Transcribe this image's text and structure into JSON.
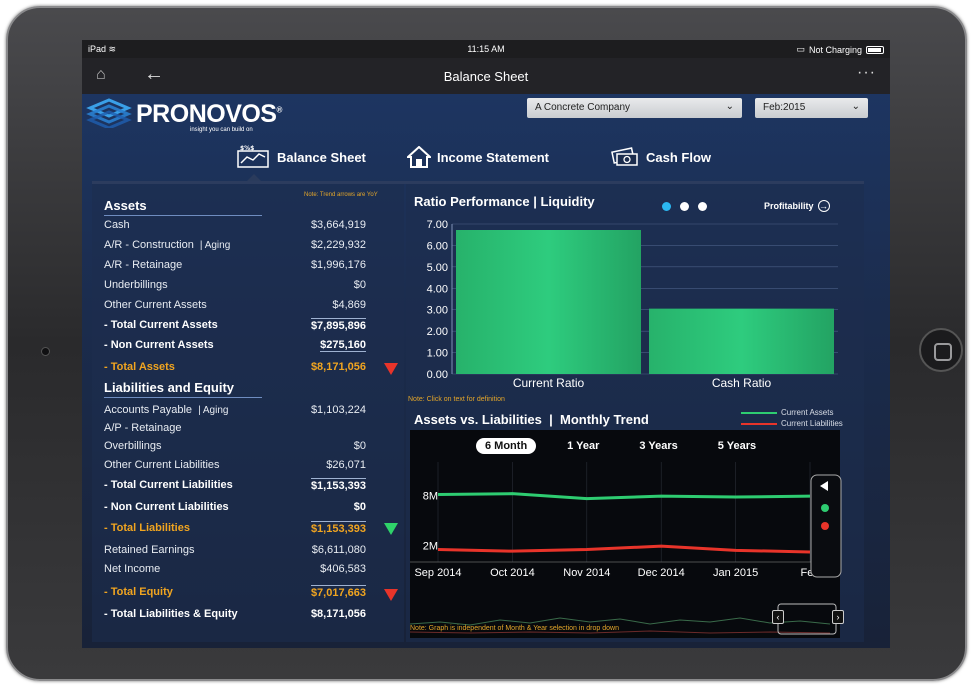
{
  "status_bar": {
    "device": "iPad",
    "time": "11:15 AM",
    "charging": "Not Charging"
  },
  "nav": {
    "title": "Balance Sheet"
  },
  "brand": {
    "name_pro": "PRO",
    "name_rest": "NOVOS",
    "reg": "®",
    "tagline": "insight you can build on"
  },
  "filters": {
    "company": "A Concrete Company",
    "period": "Feb:2015"
  },
  "tabs": [
    {
      "label": "Balance Sheet"
    },
    {
      "label": "Income Statement"
    },
    {
      "label": "Cash Flow"
    }
  ],
  "left": {
    "trend_note": "Note: Trend arrows are YoY",
    "assets_title": "Assets",
    "assets": [
      {
        "label": "Cash",
        "value": "$3,664,919"
      },
      {
        "label": "A/R - Construction",
        "aging": "| Aging",
        "value": "$2,229,932"
      },
      {
        "label": "A/R - Retainage",
        "value": "$1,996,176"
      },
      {
        "label": "Underbillings",
        "value": "$0"
      },
      {
        "label": "Other Current Assets",
        "value": "$4,869"
      },
      {
        "label": "- Total Current Assets",
        "value": "$7,895,896"
      },
      {
        "label": "- Non Current Assets",
        "value": "$275,160"
      },
      {
        "label": "- Total Assets",
        "value": "$8,171,056"
      }
    ],
    "liab_title": "Liabilities and Equity",
    "liabilities": [
      {
        "label": "Accounts Payable",
        "aging": "| Aging",
        "value": "$1,103,224"
      },
      {
        "label": "A/P - Retainage",
        "value": ""
      },
      {
        "label": "Overbillings",
        "value": "$0"
      },
      {
        "label": "Other Current Liabilities",
        "value": "$26,071"
      },
      {
        "label": "- Total Current Liabilities",
        "value": "$1,153,393"
      },
      {
        "label": "- Non Current Liabilities",
        "value": "$0"
      },
      {
        "label": "- Total Liabilities",
        "value": "$1,153,393"
      },
      {
        "label": "Retained Earnings",
        "value": "$6,611,080"
      },
      {
        "label": "Net Income",
        "value": "$406,583"
      },
      {
        "label": "- Total Equity",
        "value": "$7,017,663"
      },
      {
        "label": "- Total Liabilities & Equity",
        "value": "$8,171,056"
      }
    ],
    "colors": {
      "down": "#e8342a",
      "up": "#2fd36a",
      "total": "#f1a520"
    }
  },
  "ratio": {
    "title": "Ratio Performance",
    "sep": "|",
    "subtitle": "Liquidity",
    "profit_link": "Profitability",
    "note": "Note: Click on text for definition"
  },
  "trend": {
    "title": "Assets vs. Liabilities",
    "sep": "|",
    "subtitle": "Monthly Trend",
    "ranges": [
      "6 Month",
      "1 Year",
      "3 Years",
      "5 Years"
    ],
    "footnote": "Note: Graph is independent of Month & Year selection in drop down"
  },
  "chart_data": [
    {
      "type": "bar",
      "categories": [
        "Current Ratio",
        "Cash Ratio"
      ],
      "values": [
        6.72,
        3.05
      ],
      "ylim": [
        0,
        7
      ],
      "yticks": [
        "0.00",
        "1.00",
        "2.00",
        "3.00",
        "4.00",
        "5.00",
        "6.00",
        "7.00"
      ],
      "grid": true,
      "color": "#2ecc7e"
    },
    {
      "type": "line",
      "x": [
        "Sep 2014",
        "Oct 2014",
        "Nov 2014",
        "Dec 2014",
        "Jan 2015",
        "Feb"
      ],
      "series": [
        {
          "name": "Current Assets",
          "values": [
            8.1,
            8.2,
            7.6,
            7.9,
            7.8,
            7.9
          ],
          "color": "#2ecc71"
        },
        {
          "name": "Current Liabilities",
          "values": [
            1.5,
            1.3,
            1.5,
            1.9,
            1.4,
            1.2
          ],
          "color": "#e8342a"
        }
      ],
      "yticks": [
        "2M",
        "8M"
      ],
      "ylim": [
        0,
        12
      ],
      "legend": "top-right"
    }
  ]
}
